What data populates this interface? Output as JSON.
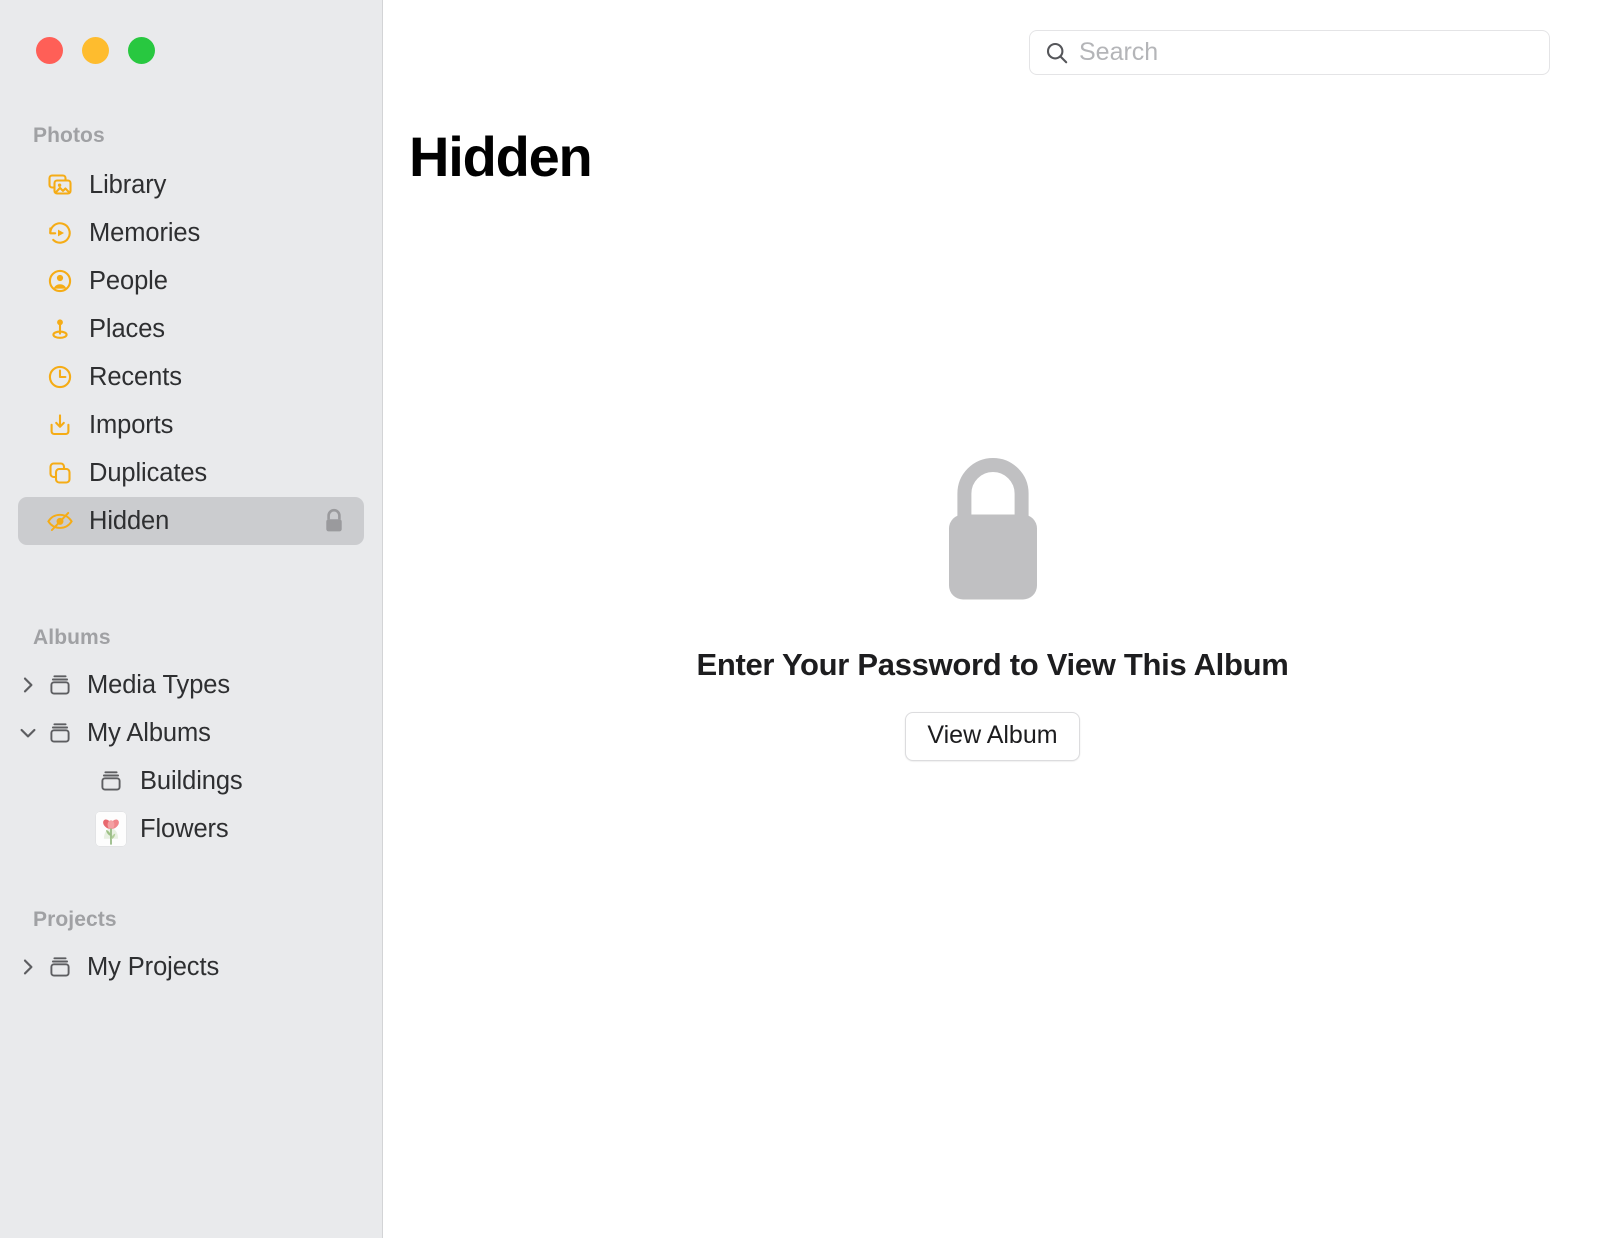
{
  "window": {
    "traffic_lights": [
      {
        "name": "close",
        "color": "#ff5f57"
      },
      {
        "name": "minimize",
        "color": "#febc2e"
      },
      {
        "name": "maximize",
        "color": "#28c840"
      }
    ]
  },
  "search": {
    "placeholder": "Search",
    "value": "",
    "icon": "search-icon"
  },
  "sidebar": {
    "sections": [
      {
        "id": "photos",
        "title": "Photos",
        "items": [
          {
            "id": "library",
            "label": "Library",
            "icon": "photo-stack-icon",
            "selected": false,
            "badge": null
          },
          {
            "id": "memories",
            "label": "Memories",
            "icon": "memories-icon",
            "selected": false,
            "badge": null
          },
          {
            "id": "people",
            "label": "People",
            "icon": "person-icon",
            "selected": false,
            "badge": null
          },
          {
            "id": "places",
            "label": "Places",
            "icon": "map-pin-icon",
            "selected": false,
            "badge": null
          },
          {
            "id": "recents",
            "label": "Recents",
            "icon": "clock-icon",
            "selected": false,
            "badge": null
          },
          {
            "id": "imports",
            "label": "Imports",
            "icon": "import-icon",
            "selected": false,
            "badge": null
          },
          {
            "id": "duplicates",
            "label": "Duplicates",
            "icon": "duplicates-icon",
            "selected": false,
            "badge": null
          },
          {
            "id": "hidden",
            "label": "Hidden",
            "icon": "eye-slash-icon",
            "selected": true,
            "badge": "lock-icon"
          }
        ]
      },
      {
        "id": "albums",
        "title": "Albums",
        "items": [
          {
            "id": "media-types",
            "label": "Media Types",
            "icon": "album-icon",
            "disclosure": "collapsed",
            "level": 0
          },
          {
            "id": "my-albums",
            "label": "My Albums",
            "icon": "album-icon",
            "disclosure": "expanded",
            "level": 0
          },
          {
            "id": "buildings",
            "label": "Buildings",
            "icon": "album-icon",
            "disclosure": null,
            "level": 1
          },
          {
            "id": "flowers",
            "label": "Flowers",
            "icon": "tulip-thumbnail",
            "disclosure": null,
            "level": 1
          }
        ]
      },
      {
        "id": "projects",
        "title": "Projects",
        "items": [
          {
            "id": "my-projects",
            "label": "My Projects",
            "icon": "album-icon",
            "disclosure": "collapsed",
            "level": 0
          }
        ]
      }
    ]
  },
  "main": {
    "title": "Hidden",
    "empty_state": {
      "icon": "lock-icon",
      "heading": "Enter Your Password to View This Album",
      "button_label": "View Album"
    }
  },
  "colors": {
    "accent_yellow": "#f5ac16",
    "sidebar_bg": "#e9eaec",
    "selection_bg": "#cbcccf",
    "section_header": "#a0a1a4",
    "label_text": "#2e2f31",
    "lock_gray": "#c0c0c2"
  }
}
